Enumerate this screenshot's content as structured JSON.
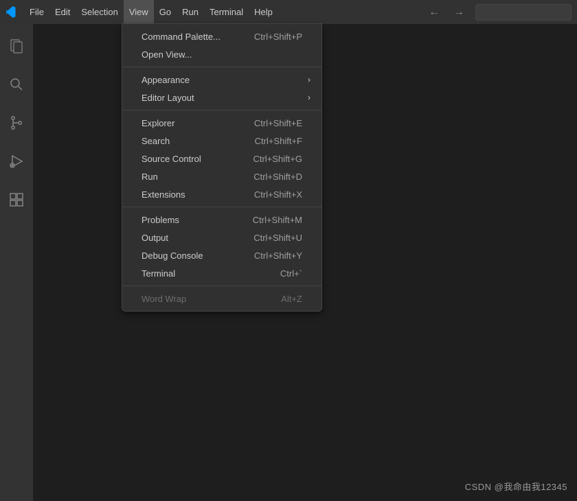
{
  "menubar": {
    "items": [
      "File",
      "Edit",
      "Selection",
      "View",
      "Go",
      "Run",
      "Terminal",
      "Help"
    ],
    "active_index": 3
  },
  "view_menu": {
    "groups": [
      [
        {
          "label": "Command Palette...",
          "shortcut": "Ctrl+Shift+P",
          "submenu": false
        },
        {
          "label": "Open View...",
          "shortcut": "",
          "submenu": false
        }
      ],
      [
        {
          "label": "Appearance",
          "shortcut": "",
          "submenu": true
        },
        {
          "label": "Editor Layout",
          "shortcut": "",
          "submenu": true
        }
      ],
      [
        {
          "label": "Explorer",
          "shortcut": "Ctrl+Shift+E",
          "submenu": false
        },
        {
          "label": "Search",
          "shortcut": "Ctrl+Shift+F",
          "submenu": false
        },
        {
          "label": "Source Control",
          "shortcut": "Ctrl+Shift+G",
          "submenu": false
        },
        {
          "label": "Run",
          "shortcut": "Ctrl+Shift+D",
          "submenu": false
        },
        {
          "label": "Extensions",
          "shortcut": "Ctrl+Shift+X",
          "submenu": false
        }
      ],
      [
        {
          "label": "Problems",
          "shortcut": "Ctrl+Shift+M",
          "submenu": false
        },
        {
          "label": "Output",
          "shortcut": "Ctrl+Shift+U",
          "submenu": false
        },
        {
          "label": "Debug Console",
          "shortcut": "Ctrl+Shift+Y",
          "submenu": false
        },
        {
          "label": "Terminal",
          "shortcut": "Ctrl+`",
          "submenu": false
        }
      ],
      [
        {
          "label": "Word Wrap",
          "shortcut": "Alt+Z",
          "submenu": false,
          "disabled": true
        }
      ]
    ]
  },
  "activity_bar": {
    "icons": [
      "explorer",
      "search",
      "source-control",
      "run-debug",
      "extensions"
    ]
  },
  "watermark": "CSDN @我命由我12345"
}
